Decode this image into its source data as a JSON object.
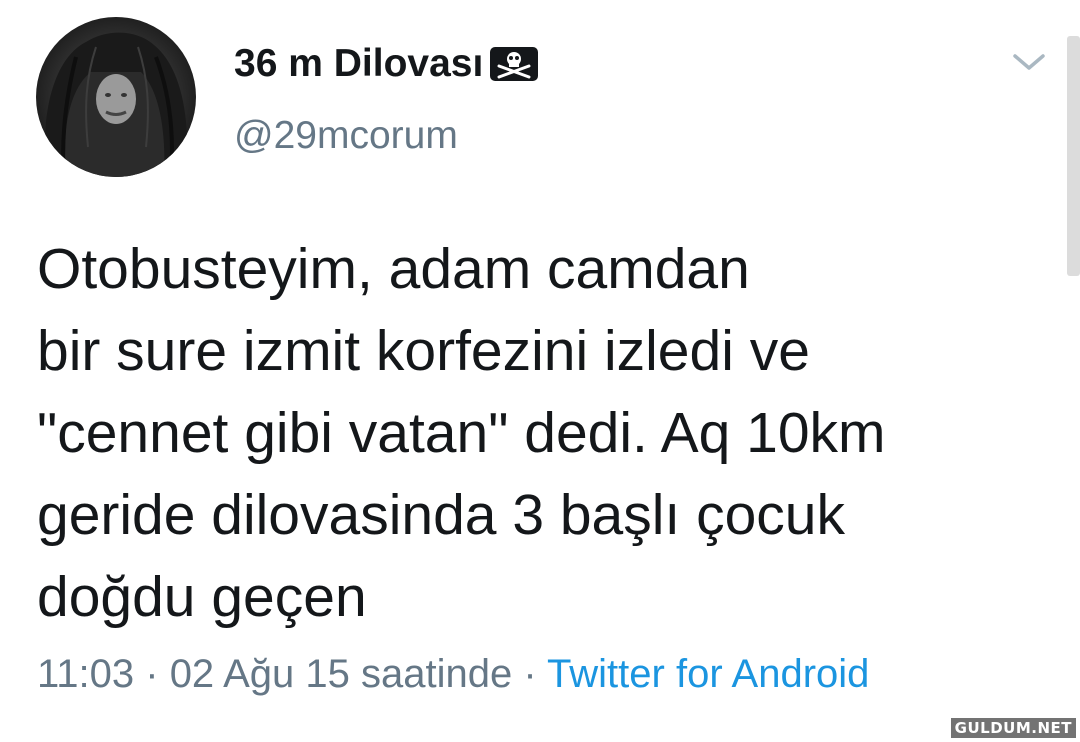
{
  "tweet": {
    "display_name": "36 m Dilovası",
    "handle": "@29mcorum",
    "text": "Otobusteyim, adam camdan\nbir sure izmit korfezini izledi ve\n\"cennet gibi vatan\" dedi. Aq 10km\ngeride dilovasinda 3 başlı çocuk\ndoğdu geçen",
    "time": "11:03",
    "date": "02 Ağu 15 saatinde",
    "source": "Twitter for Android",
    "separator": " · "
  },
  "icons": {
    "name_badge": "skull-crossbones-flag-icon",
    "menu": "chevron-down-icon"
  },
  "watermark": "GULDUM.NET",
  "colors": {
    "text": "#14171a",
    "secondary": "#657786",
    "link": "#1b95e0"
  }
}
